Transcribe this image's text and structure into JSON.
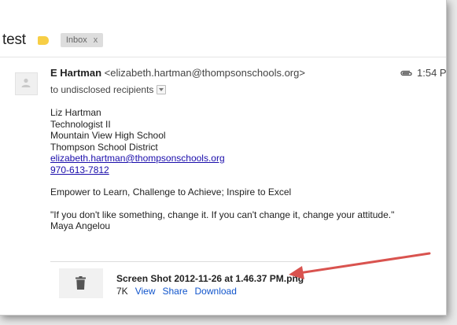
{
  "subject": "test",
  "label_chip": {
    "text": "Inbox",
    "remove": "x"
  },
  "colors": {
    "label_marker": "#f7ce45",
    "link": "#1155cc",
    "annotation_arrow": "#d9534f"
  },
  "message": {
    "sender_name": "E Hartman",
    "sender_email": "<elizabeth.hartman@thompsonschools.org>",
    "time": "1:54 P",
    "recipients": "to undisclosed recipients",
    "attachment_icon": "paperclip-icon",
    "body": {
      "sig_name": "Liz Hartman",
      "sig_title": "Technologist II",
      "sig_school": "Mountain View High School",
      "sig_district": "Thompson School District",
      "sig_email": "elizabeth.hartman@thompsonschools.org",
      "sig_phone": "970-613-7812",
      "motto": "Empower to Learn, Challenge to Achieve; Inspire to Excel",
      "quote": "\"If you don't like something, change it.  If you can't change it, change your attitude.\"",
      "quote_author": "Maya Angelou"
    }
  },
  "attachment": {
    "icon": "trash-icon",
    "filename": "Screen Shot 2012-11-26 at 1.46.37 PM.png",
    "size": "7K",
    "view": "View",
    "share": "Share",
    "download": "Download"
  }
}
